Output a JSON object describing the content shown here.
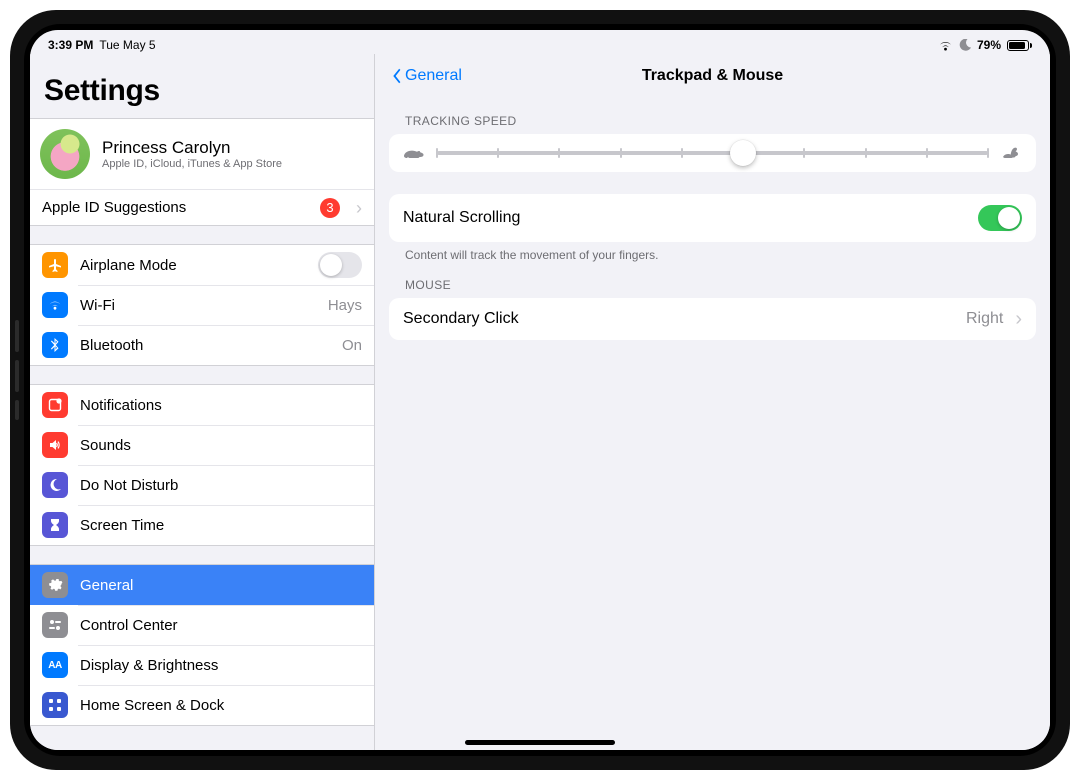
{
  "status": {
    "time": "3:39 PM",
    "date": "Tue May 5",
    "battery_pct": "79%"
  },
  "sidebar": {
    "title": "Settings",
    "profile": {
      "name": "Princess Carolyn",
      "sub": "Apple ID, iCloud, iTunes & App Store"
    },
    "apple_id_suggestions": {
      "label": "Apple ID Suggestions",
      "badge": "3"
    },
    "items": {
      "airplane": {
        "label": "Airplane Mode",
        "on": false
      },
      "wifi": {
        "label": "Wi-Fi",
        "value": "Hays"
      },
      "bluetooth": {
        "label": "Bluetooth",
        "value": "On"
      },
      "notifications": {
        "label": "Notifications"
      },
      "sounds": {
        "label": "Sounds"
      },
      "dnd": {
        "label": "Do Not Disturb"
      },
      "screen_time": {
        "label": "Screen Time"
      },
      "general": {
        "label": "General"
      },
      "control": {
        "label": "Control Center"
      },
      "display": {
        "label": "Display & Brightness"
      },
      "home": {
        "label": "Home Screen & Dock"
      }
    }
  },
  "detail": {
    "back": "General",
    "title": "Trackpad & Mouse",
    "tracking": {
      "header": "TRACKING SPEED",
      "ticks": 10,
      "value": 6
    },
    "natural": {
      "label": "Natural Scrolling",
      "on": true,
      "footer": "Content will track the movement of your fingers."
    },
    "mouse": {
      "header": "MOUSE",
      "secondary_label": "Secondary Click",
      "secondary_value": "Right"
    }
  }
}
